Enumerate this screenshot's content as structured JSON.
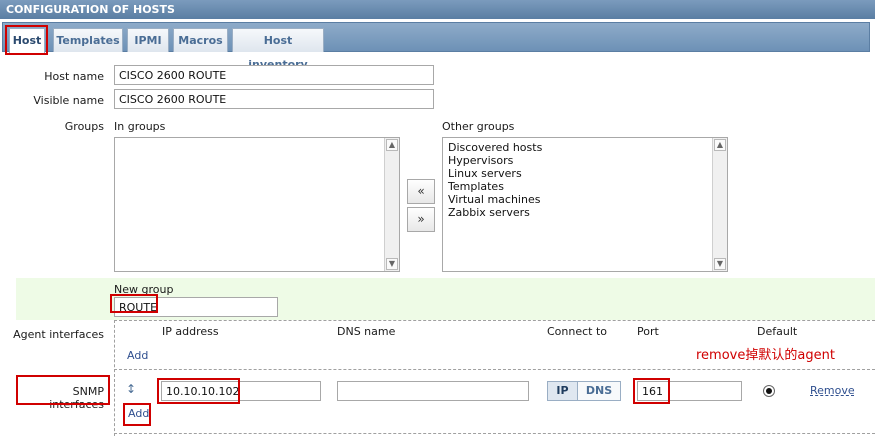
{
  "header": {
    "title": "CONFIGURATION OF HOSTS"
  },
  "tabs": [
    {
      "label": "Host",
      "active": true
    },
    {
      "label": "Templates",
      "active": false
    },
    {
      "label": "IPMI",
      "active": false
    },
    {
      "label": "Macros",
      "active": false
    },
    {
      "label": "Host inventory",
      "active": false
    }
  ],
  "form": {
    "host_name_label": "Host name",
    "host_name_value": "CISCO 2600 ROUTE",
    "visible_name_label": "Visible name",
    "visible_name_value": "CISCO 2600 ROUTE",
    "groups_label": "Groups",
    "in_groups_label": "In groups",
    "in_groups": [],
    "other_groups_label": "Other groups",
    "other_groups": [
      "Discovered hosts",
      "Hypervisors",
      "Linux servers",
      "Templates",
      "Virtual machines",
      "Zabbix servers"
    ],
    "move_left_label": "«",
    "move_right_label": "»",
    "new_group_label": "New group",
    "new_group_value": "ROUTE"
  },
  "interfaces": {
    "agent_label": "Agent interfaces",
    "snmp_label": "SNMP interfaces",
    "columns": {
      "ip": "IP address",
      "dns": "DNS name",
      "connect": "Connect to",
      "port": "Port",
      "default": "Default"
    },
    "agent_add_label": "Add",
    "snmp_row": {
      "ip": "10.10.10.102",
      "dns": "",
      "connect_ip": "IP",
      "connect_dns": "DNS",
      "connect_selected": "IP",
      "port": "161",
      "is_default": true,
      "remove_label": "Remove",
      "drag_icon": "updown-arrow-icon"
    },
    "snmp_add_label": "Add"
  },
  "annotation": {
    "text": "remove掉默认的agent",
    "color": "#d00000"
  },
  "colors": {
    "accent": "#5a7ea3",
    "highlight": "#d00000",
    "new_group_bg": "#eefbe6"
  }
}
